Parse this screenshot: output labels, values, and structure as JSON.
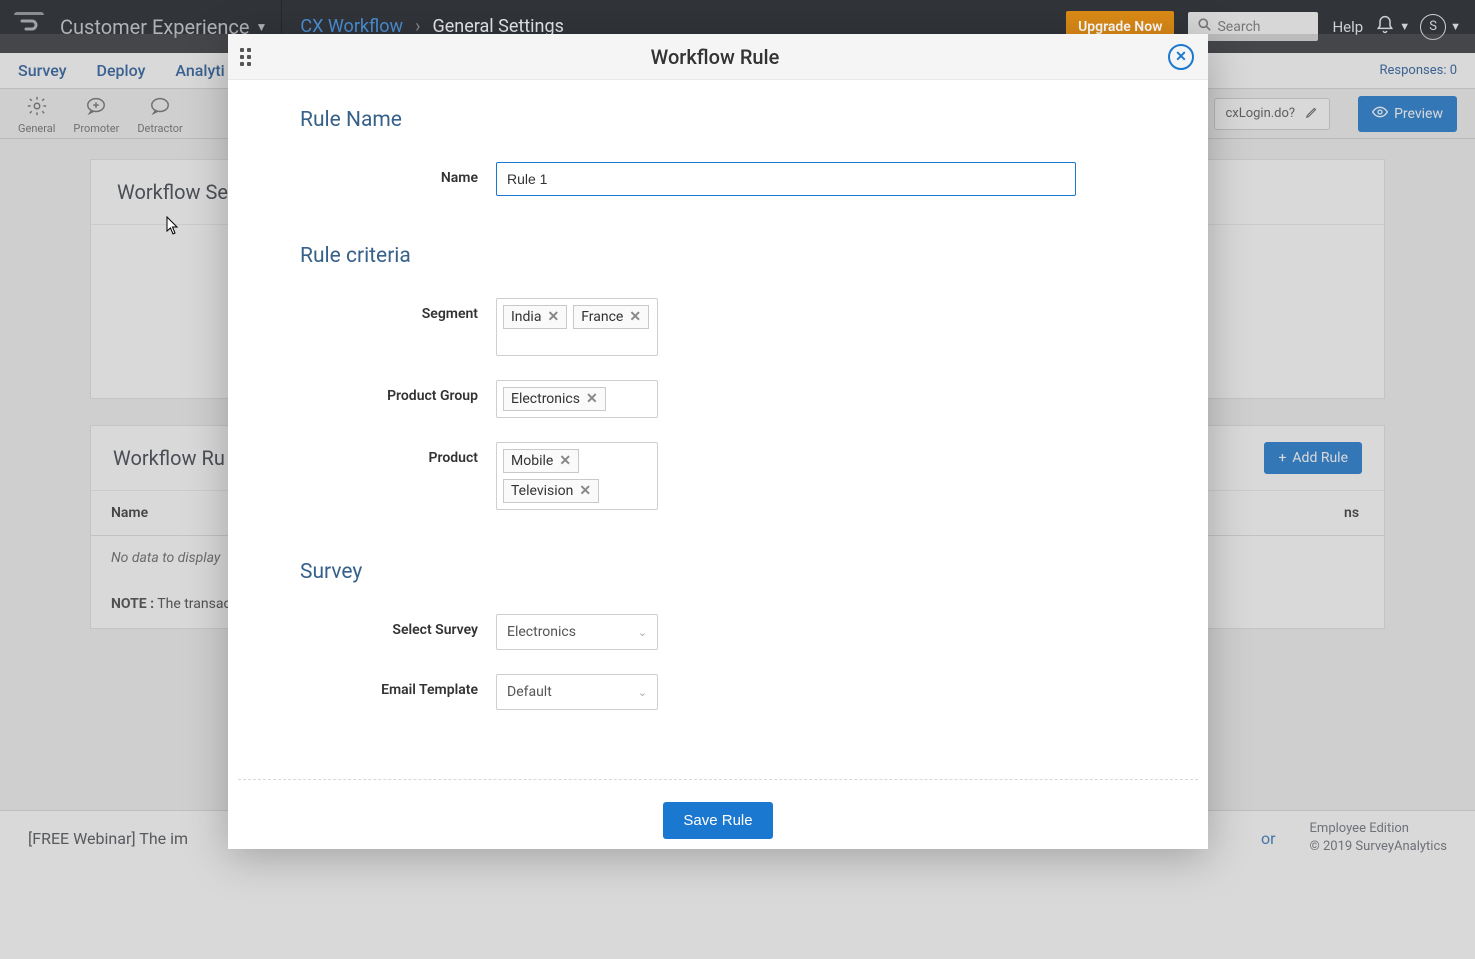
{
  "header": {
    "brand": "Customer Experience",
    "breadcrumb_link": "CX Workflow",
    "breadcrumb_current": "General Settings",
    "upgrade": "Upgrade Now",
    "search_placeholder": "Search",
    "help": "Help",
    "avatar_letter": "S"
  },
  "navtabs": {
    "tabs": [
      "Survey",
      "Deploy",
      "Analyti"
    ],
    "responses_label": "Responses: 0"
  },
  "toolbar": {
    "general": "General",
    "promoter": "Promoter",
    "detractor": "Detractor",
    "url_fragment": "cxLogin.do?",
    "preview": "Preview"
  },
  "page": {
    "workflow_settings_title": "Workflow Se",
    "workflow_rules_title": "Workflow Ru",
    "add_rule": "Add Rule",
    "tbl_name_header": "Name",
    "tbl_actions_header": "ns",
    "tbl_empty": "No data to display",
    "note_label": "NOTE :",
    "note_text": " The transact"
  },
  "footer": {
    "webinar": "[FREE Webinar] The im",
    "or_text": "or",
    "edition": "Employee Edition",
    "copyright": "© 2019 SurveyAnalytics"
  },
  "modal": {
    "title": "Workflow Rule",
    "sections": {
      "rule_name": "Rule Name",
      "rule_criteria": "Rule criteria",
      "survey": "Survey"
    },
    "labels": {
      "name": "Name",
      "segment": "Segment",
      "product_group": "Product Group",
      "product": "Product",
      "select_survey": "Select Survey",
      "email_template": "Email Template"
    },
    "values": {
      "name": "Rule 1",
      "segments": [
        "India",
        "France"
      ],
      "product_groups": [
        "Electronics"
      ],
      "products": [
        "Mobile",
        "Television"
      ],
      "select_survey": "Electronics",
      "email_template": "Default"
    },
    "save": "Save Rule"
  }
}
